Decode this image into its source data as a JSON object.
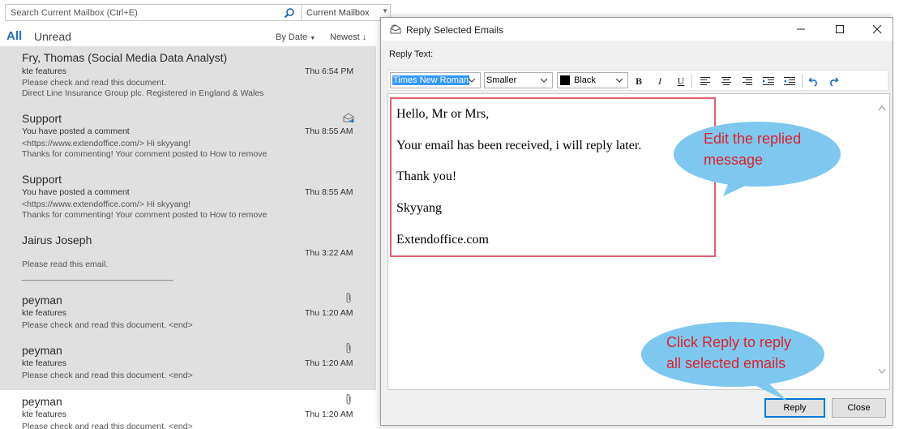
{
  "search": {
    "placeholder": "Search Current Mailbox (Ctrl+E)",
    "scope": "Current Mailbox"
  },
  "filters": {
    "all": "All",
    "unread": "Unread",
    "sort": "By Date",
    "order": "Newest"
  },
  "messages": [
    {
      "sender": "Fry, Thomas (Social Media Data Analyst)",
      "subject": "kte features",
      "time": "Thu 6:54 PM",
      "preview1": "Please check and read this document.",
      "preview2": "Direct Line Insurance Group plc. Registered in England & Wales",
      "icon": ""
    },
    {
      "sender": "Support",
      "subject": "You have posted a comment",
      "time": "Thu 8:55 AM",
      "preview1": "<https://www.extendoffice.com/>    Hi skyyang!",
      "preview2": "Thanks for commenting! Your comment posted to How to remove",
      "icon": "reply-forward-icon"
    },
    {
      "sender": "Support",
      "subject": "You have posted a comment",
      "time": "Thu 8:55 AM",
      "preview1": "<https://www.extendoffice.com/>    Hi skyyang!",
      "preview2": "Thanks for commenting! Your comment posted to How to remove",
      "icon": ""
    },
    {
      "sender": "Jairus Joseph",
      "subject": "",
      "time": "Thu 3:22 AM",
      "preview1": "Please read this email.",
      "preview2": "________________________________",
      "icon": ""
    },
    {
      "sender": "peyman",
      "subject": "kte features",
      "time": "Thu 1:20 AM",
      "preview1": "Please check and read this document. <end>",
      "preview2": "",
      "icon": "paperclip-icon"
    },
    {
      "sender": "peyman",
      "subject": "kte features",
      "time": "Thu 1:20 AM",
      "preview1": "Please check and read this document. <end>",
      "preview2": "",
      "icon": "paperclip-icon"
    },
    {
      "sender": "peyman",
      "subject": "kte features",
      "time": "Thu 1:20 AM",
      "preview1": "Please check and read this document. <end>",
      "preview2": "",
      "icon": "paperclip-icon"
    }
  ],
  "dialog": {
    "title": "Reply Selected Emails",
    "reply_label": "Reply Text:",
    "font": "Times New Roman",
    "size": "Smaller",
    "color_name": "Black",
    "color_hex": "#000000",
    "body": [
      "Hello, Mr or Mrs,",
      "Your email has been received, i will reply later.",
      "Thank you!",
      "Skyyang",
      "Extendoffice.com"
    ],
    "reply_button": "Reply",
    "close_button": "Close"
  },
  "callouts": {
    "edit": [
      "Edit the replied",
      "message"
    ],
    "reply": [
      "Click Reply to reply",
      "all selected emails"
    ]
  },
  "colors": {
    "accent": "#1e6fc2",
    "callout_fill": "#7ec8ef",
    "callout_text": "#e0202a",
    "highlight_box": "#e06070"
  }
}
